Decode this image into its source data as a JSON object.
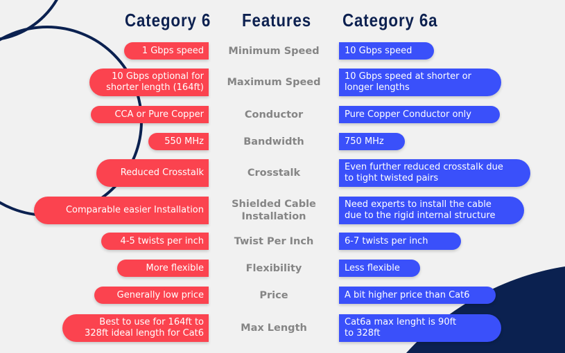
{
  "headers": {
    "left": "Category 6",
    "middle": "Features",
    "right": "Category 6a"
  },
  "colors": {
    "background": "#f1f1f1",
    "heading": "#0d2150",
    "cat6_pill": "#fb434f",
    "cat6a_pill": "#3a50fa",
    "feature_text": "#858585",
    "decoration_navy": "#0b2150"
  },
  "rows": [
    {
      "feature": [
        "Minimum Speed"
      ],
      "cat6": [
        "1 Gbps speed"
      ],
      "cat6a": [
        "10 Gbps speed"
      ]
    },
    {
      "feature": [
        "Maximum Speed"
      ],
      "cat6": [
        "10 Gbps optional for",
        "shorter length (164ft)"
      ],
      "cat6a": [
        "10 Gbps speed at shorter or",
        "longer lengths"
      ]
    },
    {
      "feature": [
        "Conductor"
      ],
      "cat6": [
        "CCA or Pure Copper"
      ],
      "cat6a": [
        "Pure Copper Conductor only"
      ]
    },
    {
      "feature": [
        "Bandwidth"
      ],
      "cat6": [
        "550 MHz"
      ],
      "cat6a": [
        "750 MHz"
      ]
    },
    {
      "feature": [
        "Crosstalk"
      ],
      "cat6": [
        "Reduced Crosstalk"
      ],
      "cat6a": [
        "Even further reduced crosstalk due",
        "to tight twisted pairs"
      ]
    },
    {
      "feature": [
        "Shielded Cable",
        "Installation"
      ],
      "cat6": [
        "Comparable easier Installation"
      ],
      "cat6a": [
        "Need experts to install the cable",
        "due to the rigid  internal structure"
      ]
    },
    {
      "feature": [
        "Twist Per Inch"
      ],
      "cat6": [
        "4-5 twists per inch"
      ],
      "cat6a": [
        "6-7 twists per inch"
      ]
    },
    {
      "feature": [
        "Flexibility"
      ],
      "cat6": [
        "More flexible"
      ],
      "cat6a": [
        "Less flexible"
      ]
    },
    {
      "feature": [
        "Price"
      ],
      "cat6": [
        "Generally low price"
      ],
      "cat6a": [
        "A bit higher price than Cat6"
      ]
    },
    {
      "feature": [
        "Max Length"
      ],
      "cat6": [
        "Best to use for 164ft to",
        "328ft ideal length for Cat6"
      ],
      "cat6a": [
        "Cat6a max lenght is 90ft",
        "to 328ft"
      ]
    }
  ]
}
